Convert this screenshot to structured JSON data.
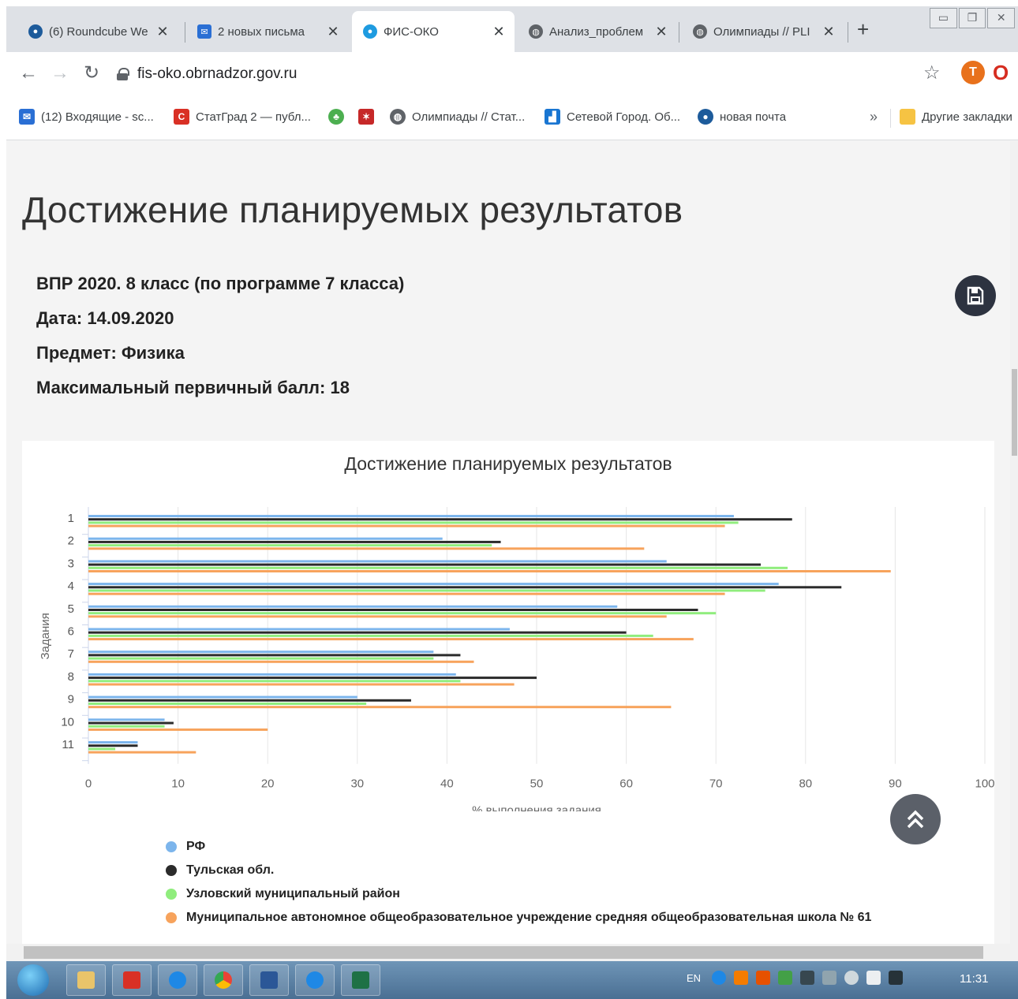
{
  "tabs": [
    {
      "title": "(6) Roundcube We",
      "icon": "roundcube-icon",
      "active": false
    },
    {
      "title": "2 новых письма",
      "icon": "mail-icon",
      "active": false
    },
    {
      "title": "ФИС-ОКО",
      "icon": "fis-oko-icon",
      "active": true
    },
    {
      "title": "Анализ_проблем",
      "icon": "globe-icon",
      "active": false
    },
    {
      "title": "Олимпиады // PLI",
      "icon": "globe-icon",
      "active": false
    }
  ],
  "address": "fis-oko.obrnadzor.gov.ru",
  "profile_initial": "T",
  "bookmarks": [
    {
      "label": "(12) Входящие - sc...",
      "icon": "mail-icon"
    },
    {
      "label": "СтатГрад 2 — публ...",
      "icon": "statgrad-icon"
    },
    {
      "label": "",
      "icon": "leaf-icon"
    },
    {
      "label": "",
      "icon": "emblem-icon"
    },
    {
      "label": "Олимпиады // Стат...",
      "icon": "globe-icon"
    },
    {
      "label": "Сетевой Город. Об...",
      "icon": "network-city-icon"
    },
    {
      "label": "новая почта",
      "icon": "mail-drop-icon"
    }
  ],
  "bookmarks_more": "»",
  "other_bookmarks": "Другие закладки",
  "page": {
    "heading": "Достижение планируемых результатов",
    "meta": [
      "ВПР 2020. 8 класс (по программе 7 класса)",
      "Дата: 14.09.2020",
      "Предмет: Физика",
      "Максимальный первичный балл: 18"
    ]
  },
  "chart_data": {
    "type": "bar",
    "orientation": "horizontal",
    "title": "Достижение планируемых результатов",
    "xlabel": "% выполнения задания",
    "ylabel": "Задания",
    "xlim": [
      0,
      100
    ],
    "xticks": [
      0,
      10,
      20,
      30,
      40,
      50,
      60,
      70,
      80,
      90,
      100
    ],
    "grid": true,
    "legend_position": "bottom-left",
    "categories": [
      "1",
      "2",
      "3",
      "4",
      "5",
      "6",
      "7",
      "8",
      "9",
      "10",
      "11"
    ],
    "series": [
      {
        "name": "РФ",
        "color": "#7cb5ec",
        "values": [
          72,
          39.5,
          64.5,
          77,
          59,
          47,
          38.5,
          41,
          30,
          8.5,
          5.5
        ]
      },
      {
        "name": "Тульская обл.",
        "color": "#2b2b2b",
        "values": [
          78.5,
          46,
          75,
          84,
          68,
          60,
          41.5,
          50,
          36,
          9.5,
          5.5
        ]
      },
      {
        "name": "Узловский муниципальный район",
        "color": "#90ed7d",
        "values": [
          72.5,
          45,
          78,
          75.5,
          70,
          63,
          38.5,
          41.5,
          31,
          8.5,
          3
        ]
      },
      {
        "name": "Муниципальное автономное общеобразовательное учреждение средняя общеобразовательная школа № 61",
        "color": "#f7a35c",
        "values": [
          71,
          62,
          89.5,
          71,
          64.5,
          67.5,
          43,
          47.5,
          65,
          20,
          12
        ]
      }
    ]
  },
  "taskbar": {
    "lang": "EN",
    "clock": "11:31"
  }
}
